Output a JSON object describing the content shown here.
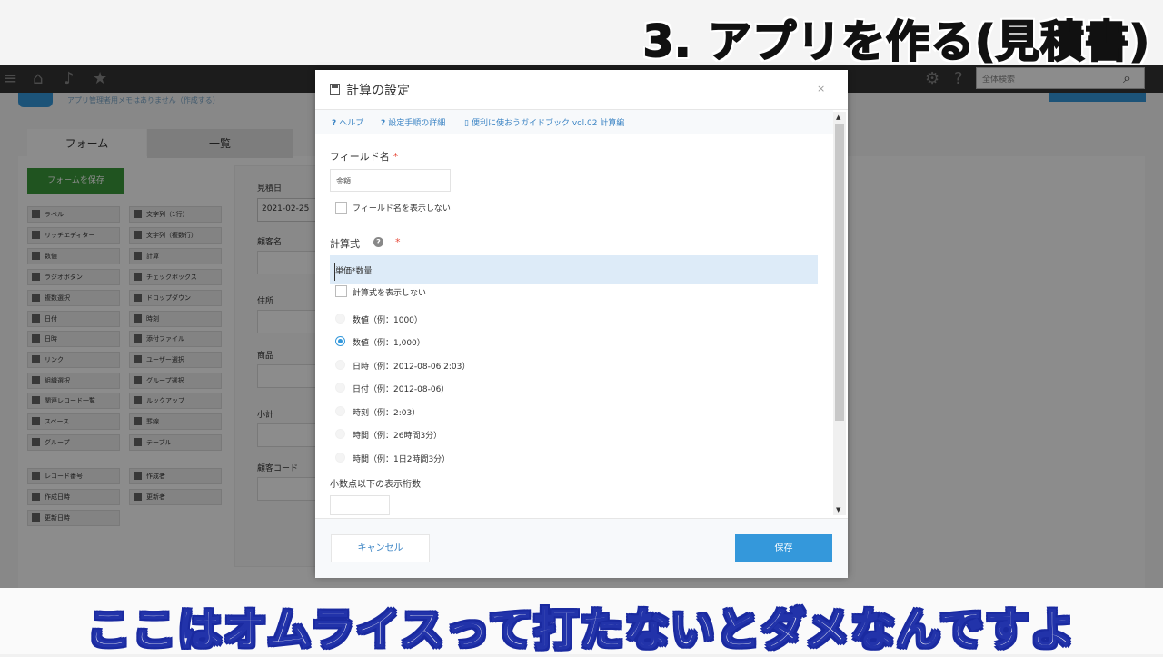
{
  "video_captions": {
    "top": "3. アプリを作る(見積書)",
    "bottom": "ここはオムライスって打たないとダメなんですよ"
  },
  "app_header": {
    "search_placeholder": "全体検索",
    "icons": [
      "menu-icon",
      "home-icon",
      "bell-icon",
      "star-icon",
      "gear-icon",
      "help-icon",
      "search-icon"
    ]
  },
  "background_app": {
    "notice": "アプリ管理者用メモはありません（作成する）",
    "tabs": [
      "フォーム",
      "一覧"
    ],
    "save_form_label": "フォームを保存",
    "palette_left": [
      "ラベル",
      "リッチエディター",
      "数値",
      "ラジオボタン",
      "複数選択",
      "日付",
      "日時",
      "リンク",
      "組織選択",
      "関連レコード一覧",
      "スペース",
      "グループ"
    ],
    "palette_right": [
      "文字列（1行）",
      "文字列（複数行）",
      "計算",
      "チェックボックス",
      "ドロップダウン",
      "時刻",
      "添付ファイル",
      "ユーザー選択",
      "グループ選択",
      "ルックアップ",
      "罫線",
      "テーブル"
    ],
    "palette_bottom_left": [
      "レコード番号",
      "作成日時",
      "更新日時"
    ],
    "palette_bottom_right": [
      "作成者",
      "更新者"
    ],
    "form_fields": [
      "見積日",
      "顧客名",
      "住所",
      "商品",
      "小計",
      "顧客コード"
    ],
    "date_value": "2021-02-25"
  },
  "dialog": {
    "title": "計算の設定",
    "close_label": "×",
    "help_links": [
      {
        "icon": "?",
        "label": "ヘルプ"
      },
      {
        "icon": "?",
        "label": "設定手順の詳細"
      },
      {
        "icon": "doc",
        "label": "便利に使おうガイドブック vol.02 計算編"
      }
    ],
    "field_name_label": "フィールド名",
    "required_mark": "*",
    "field_name_value": "金額",
    "hide_field_name_label": "フィールド名を表示しない",
    "formula_label": "計算式",
    "formula_value": "単価*数量",
    "hide_formula_label": "計算式を表示しない",
    "format_options": [
      {
        "label": "数値（例：1000）",
        "selected": false
      },
      {
        "label": "数値（例：1,000）",
        "selected": true
      },
      {
        "label": "日時（例：2012-08-06 2:03）",
        "selected": false
      },
      {
        "label": "日付（例：2012-08-06）",
        "selected": false
      },
      {
        "label": "時刻（例：2:03）",
        "selected": false
      },
      {
        "label": "時間（例：26時間3分）",
        "selected": false
      },
      {
        "label": "時間（例：1日2時間3分）",
        "selected": false
      }
    ],
    "decimal_places_label": "小数点以下の表示桁数",
    "cancel_label": "キャンセル",
    "save_label": "保存",
    "colors": {
      "accent": "#3498db",
      "link": "#3b84c4",
      "required": "#e74c3c"
    }
  }
}
